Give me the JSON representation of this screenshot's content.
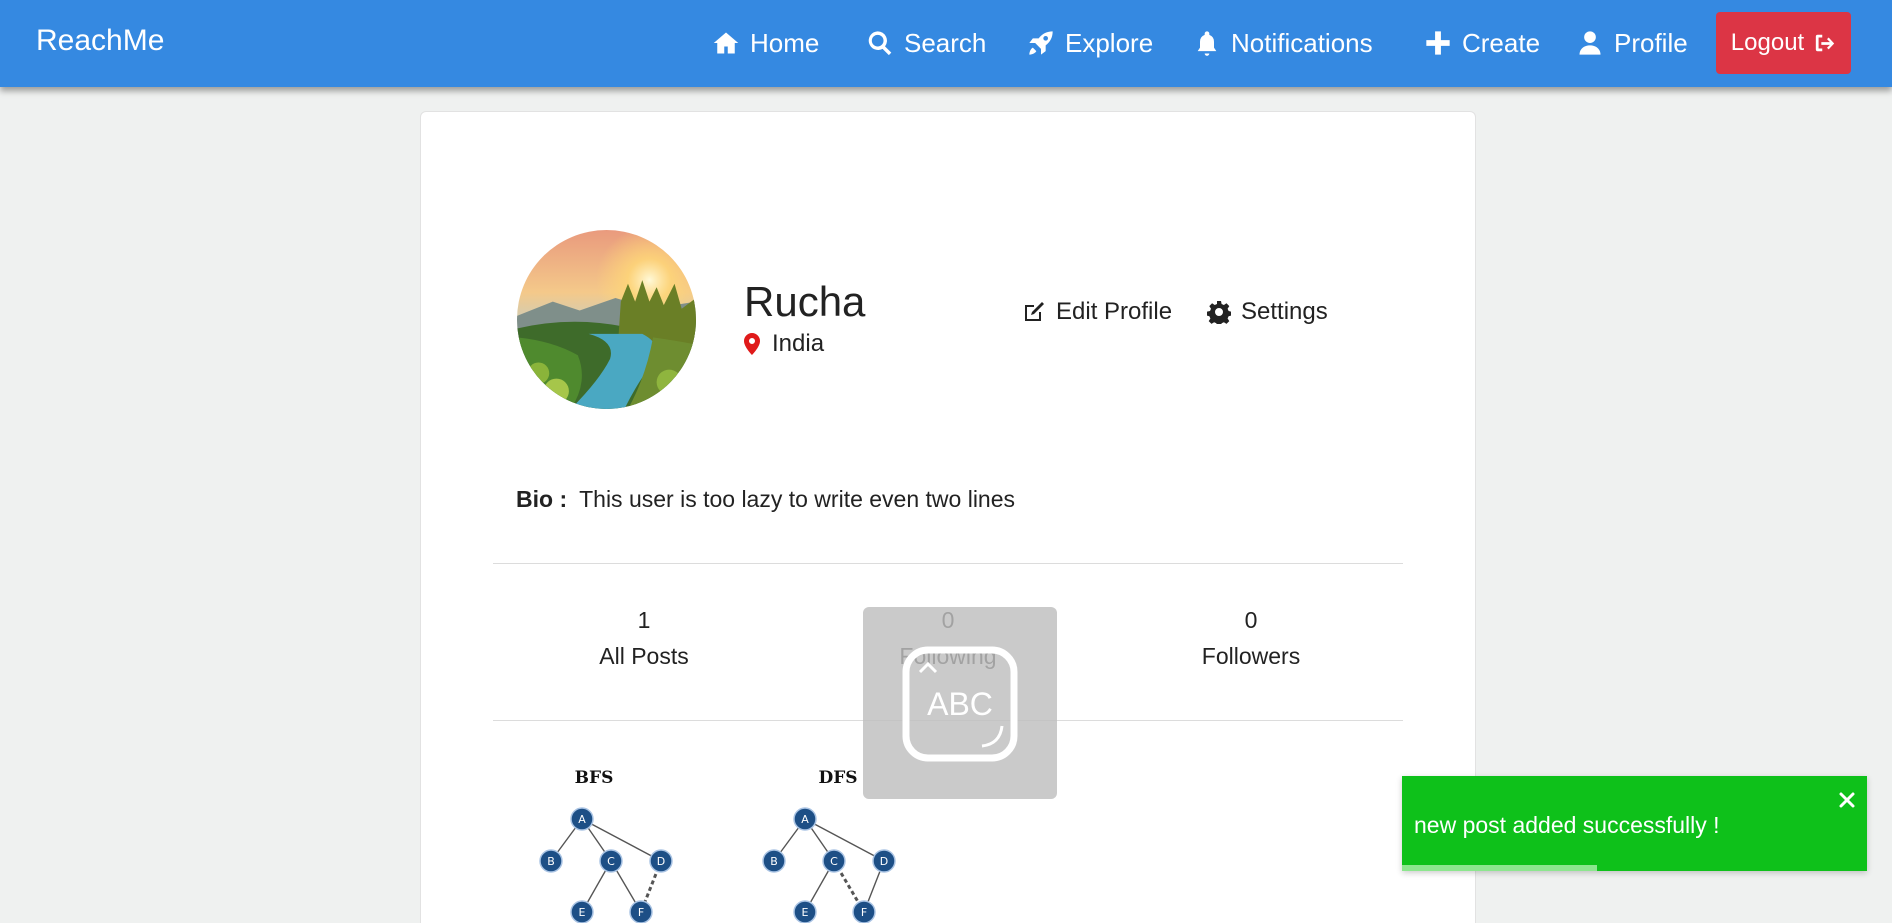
{
  "navbar": {
    "brand": "ReachMe",
    "items": [
      {
        "label": "Home",
        "icon": "home-icon"
      },
      {
        "label": "Search",
        "icon": "search-icon"
      },
      {
        "label": "Explore",
        "icon": "rocket-icon"
      },
      {
        "label": "Notifications",
        "icon": "bell-icon"
      },
      {
        "label": "Create",
        "icon": "plus-icon"
      },
      {
        "label": "Profile",
        "icon": "user-icon"
      }
    ],
    "logout_label": "Logout",
    "logout_icon": "sign-out-icon",
    "colors": {
      "bar": "#3589e1",
      "logout": "#dc3545"
    }
  },
  "profile": {
    "name": "Rucha",
    "location": "India",
    "edit_label": "Edit Profile",
    "settings_label": "Settings",
    "bio_label": "Bio :",
    "bio_text": "This user is too lazy to write even two lines"
  },
  "stats": [
    {
      "value": "1",
      "label": "All Posts"
    },
    {
      "value": "0",
      "label": "Following"
    },
    {
      "value": "0",
      "label": "Followers"
    }
  ],
  "posts": [
    {
      "title": "BFS"
    },
    {
      "title": "DFS"
    }
  ],
  "graph_nodes": [
    "A",
    "B",
    "C",
    "D",
    "E",
    "F"
  ],
  "toast": {
    "message": "new post added successfully !",
    "color": "#0ec11a",
    "progress": 0.42
  }
}
